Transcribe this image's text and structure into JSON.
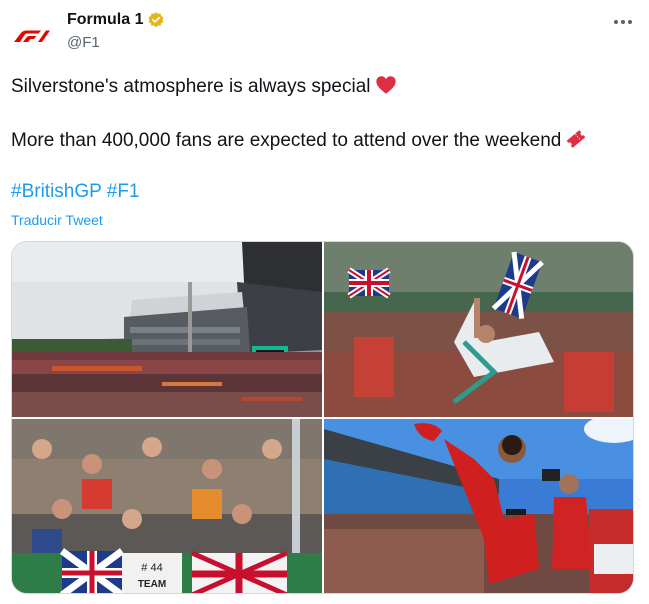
{
  "author": {
    "display_name": "Formula 1",
    "handle": "@F1",
    "avatar_icon": "f1-logo-icon",
    "verified_icon": "verified-badge-icon",
    "brand_color": "#e10600",
    "verified_color": "#e2b719"
  },
  "menu": {
    "icon": "more-options-icon"
  },
  "tweet": {
    "line1": "Silverstone's atmosphere is always special",
    "line1_emoji": "red-heart-icon",
    "line2": "More than 400,000 fans are expected to attend over the weekend",
    "line2_emoji": "ticket-icon",
    "hashtags": [
      "#BritishGP",
      "#F1"
    ]
  },
  "translate_label": "Traducir Tweet",
  "media": {
    "photos": [
      {
        "name": "grandstand-photo"
      },
      {
        "name": "driver-crowd-surf-photo"
      },
      {
        "name": "fans-stand-photo"
      },
      {
        "name": "driver-celebration-photo"
      }
    ],
    "banner_text": "TEAM",
    "banner_numbers": "# 44"
  },
  "colors": {
    "text": "#0f1419",
    "secondary": "#536471",
    "link": "#1d9bf0"
  }
}
